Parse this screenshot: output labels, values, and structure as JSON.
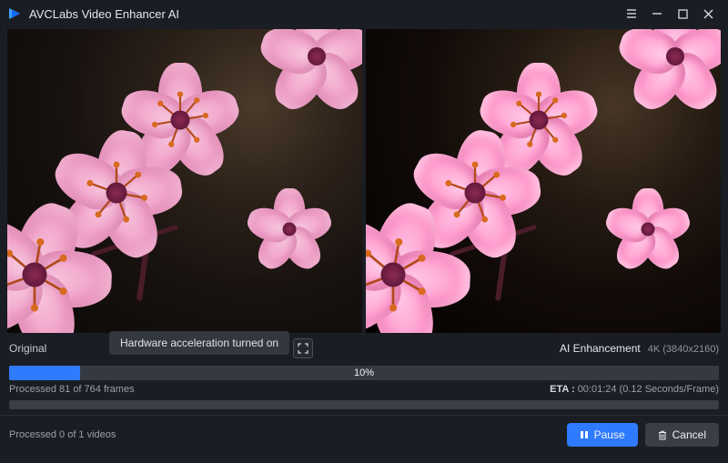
{
  "titlebar": {
    "app_name": "AVCLabs Video Enhancer AI"
  },
  "preview": {
    "left_label": "Original",
    "right_label": "AI Enhancement",
    "right_resolution": "4K (3840x2160)",
    "tooltip": "Hardware acceleration turned on"
  },
  "progress": {
    "percent_label": "10%",
    "percent_value": 10,
    "frames_status": "Processed 81 of 764 frames",
    "eta_label": "ETA :",
    "eta_value": "00:01:24 (0.12 Seconds/Frame)"
  },
  "footer": {
    "videos_status": "Processed 0 of 1 videos",
    "pause_label": "Pause",
    "cancel_label": "Cancel"
  }
}
